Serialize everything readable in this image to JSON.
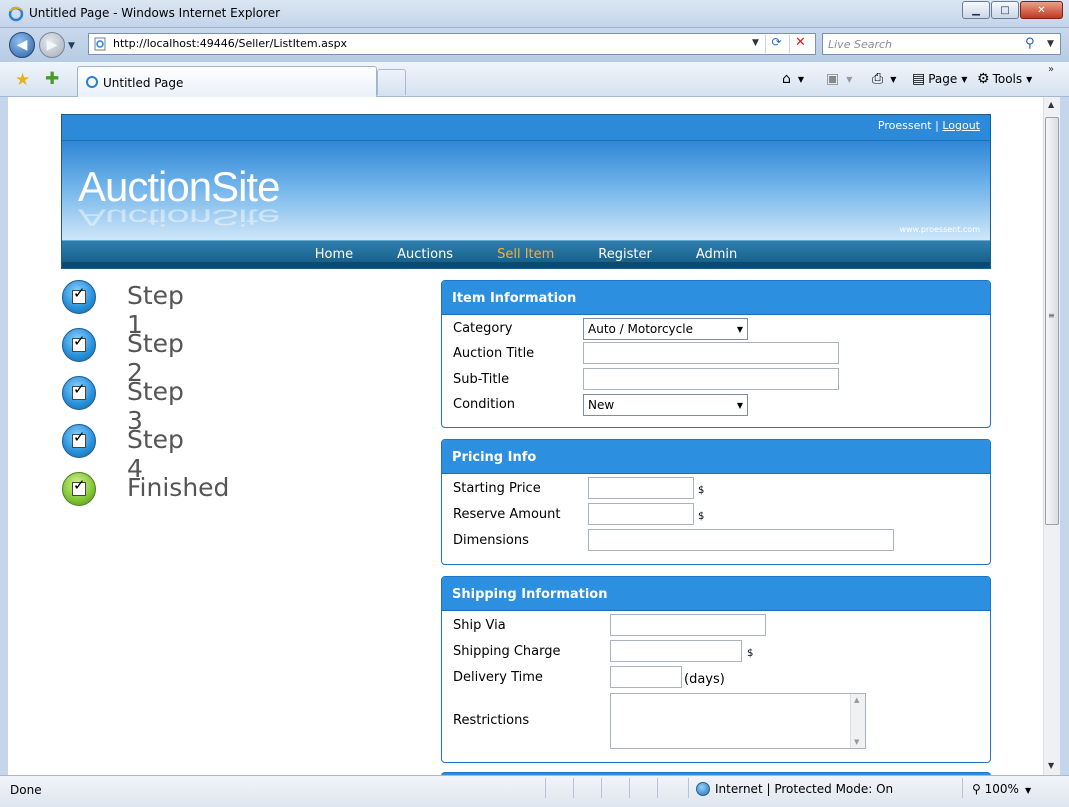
{
  "window": {
    "title": "Untitled Page - Windows Internet Explorer",
    "minimize_label": "▁",
    "maximize_label": "□",
    "close_label": "✕"
  },
  "address_bar": {
    "url": "http://localhost:49446/Seller/ListItem.aspx"
  },
  "search": {
    "placeholder": "Live Search"
  },
  "tab": {
    "label": "Untitled Page"
  },
  "commands": {
    "page_label": "Page",
    "tools_label": "Tools"
  },
  "site": {
    "user_name": "Proessent",
    "separator": " | ",
    "logout_label": "Logout",
    "logo_text": "AuctionSite",
    "watermark": "www.proessent.com",
    "nav": [
      {
        "label": "Home",
        "active": false
      },
      {
        "label": "Auctions",
        "active": false
      },
      {
        "label": "Sell Item",
        "active": true
      },
      {
        "label": "Register",
        "active": false
      },
      {
        "label": "Admin",
        "active": false
      }
    ]
  },
  "steps": [
    {
      "label": "Step 1",
      "icon": "check-blue-icon"
    },
    {
      "label": "Step 2",
      "icon": "check-blue-icon"
    },
    {
      "label": "Step 3",
      "icon": "check-blue-icon"
    },
    {
      "label": "Step 4",
      "icon": "check-blue-icon"
    },
    {
      "label": "Finished",
      "icon": "check-green-icon"
    }
  ],
  "item_information": {
    "title": "Item Information",
    "category_label": "Category",
    "category_value": "Auto / Motorcycle",
    "auction_title_label": "Auction Title",
    "auction_title_value": "",
    "subtitle_label": "Sub-Title",
    "subtitle_value": "",
    "condition_label": "Condition",
    "condition_value": "New"
  },
  "pricing_info": {
    "title": "Pricing Info",
    "starting_price_label": "Starting Price",
    "starting_price_value": "",
    "reserve_amount_label": "Reserve Amount",
    "reserve_amount_value": "",
    "dimensions_label": "Dimensions",
    "dimensions_value": "",
    "currency": "$"
  },
  "shipping_information": {
    "title": "Shipping Information",
    "ship_via_label": "Ship Via",
    "ship_via_value": "",
    "shipping_charge_label": "Shipping Charge",
    "shipping_charge_value": "",
    "delivery_time_label": "Delivery Time",
    "delivery_time_value": "",
    "delivery_unit": "(days)",
    "restrictions_label": "Restrictions",
    "restrictions_value": "",
    "currency": "$"
  },
  "status_bar": {
    "status": "Done",
    "zone": "Internet | Protected Mode: On",
    "zoom": "100%"
  },
  "colors": {
    "panel_header": "#2c8fe0",
    "nav_active": "#f2b232"
  }
}
